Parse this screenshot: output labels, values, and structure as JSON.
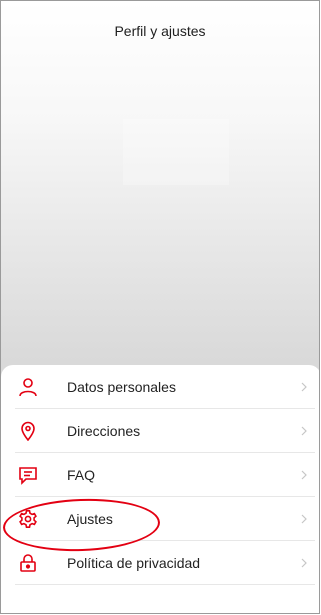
{
  "header": {
    "title": "Perfil y ajustes"
  },
  "menu": {
    "items": [
      {
        "label": "Datos personales",
        "icon": "user-icon"
      },
      {
        "label": "Direcciones",
        "icon": "location-pin-icon"
      },
      {
        "label": "FAQ",
        "icon": "chat-icon"
      },
      {
        "label": "Ajustes",
        "icon": "gear-icon"
      },
      {
        "label": "Política de privacidad",
        "icon": "lock-icon"
      }
    ]
  },
  "colors": {
    "accent": "#e30012",
    "chevron": "#c6c6c6",
    "text": "#222222"
  }
}
